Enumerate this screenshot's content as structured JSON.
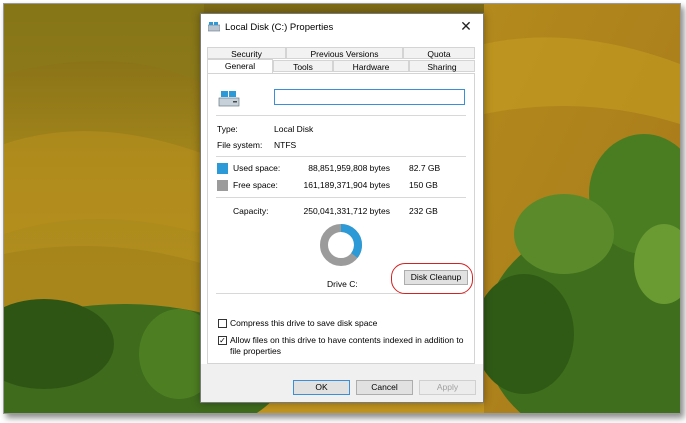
{
  "dialog": {
    "title": "Local Disk (C:) Properties",
    "close_glyph": "✕"
  },
  "tabs": {
    "row_top": [
      "Security",
      "Previous Versions",
      "Quota"
    ],
    "row_bottom": [
      "General",
      "Tools",
      "Hardware",
      "Sharing"
    ],
    "active": "General"
  },
  "general": {
    "name_value": "",
    "type_label": "Type:",
    "type_value": "Local Disk",
    "fs_label": "File system:",
    "fs_value": "NTFS",
    "used": {
      "label": "Used space:",
      "bytes": "88,851,959,808 bytes",
      "size": "82.7 GB",
      "color": "#2b9ad6"
    },
    "free": {
      "label": "Free space:",
      "bytes": "161,189,371,904 bytes",
      "size": "150 GB",
      "color": "#9b9b9b"
    },
    "capacity": {
      "label": "Capacity:",
      "bytes": "250,041,331,712 bytes",
      "size": "232 GB"
    },
    "used_fraction": 0.355,
    "drive_label": "Drive C:",
    "cleanup_button": "Disk Cleanup"
  },
  "options": {
    "compress": {
      "label": "Compress this drive to save disk space",
      "checked": false
    },
    "index_line1": "Allow files on this drive to have contents indexed in addition to",
    "index_line2": "file properties",
    "index_checked": true
  },
  "buttons": {
    "ok": "OK",
    "cancel": "Cancel",
    "apply": "Apply"
  }
}
